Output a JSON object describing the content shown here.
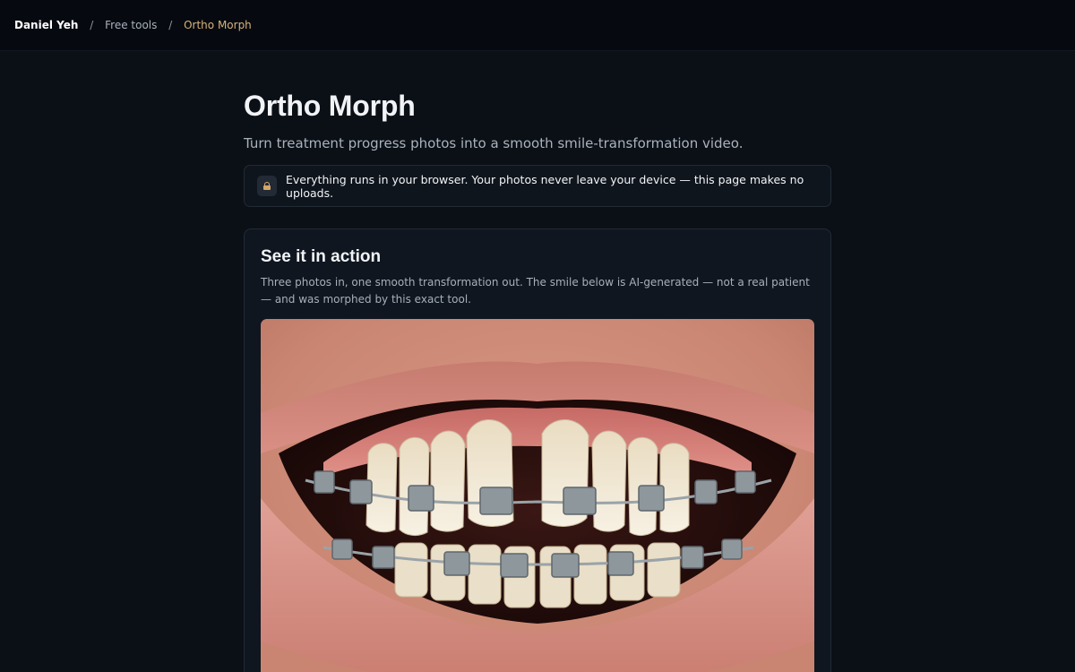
{
  "breadcrumb": {
    "home": "Daniel Yeh",
    "separator": "/",
    "section": "Free tools",
    "current": "Ortho Morph"
  },
  "page": {
    "title": "Ortho Morph",
    "subtitle": "Turn treatment progress photos into a smooth smile-transformation video."
  },
  "notice": {
    "icon": "lock-icon",
    "text": "Everything runs in your browser. Your photos never leave your device — this page makes no uploads."
  },
  "demo": {
    "title": "See it in action",
    "description": "Three photos in, one smooth transformation out. The smile below is AI-generated — not a real patient — and was morphed by this exact tool."
  },
  "colors": {
    "background": "#0b1017",
    "topbar": "#060a10",
    "accent": "#d8b27a",
    "card": "#0f1620",
    "border": "#222a35"
  }
}
